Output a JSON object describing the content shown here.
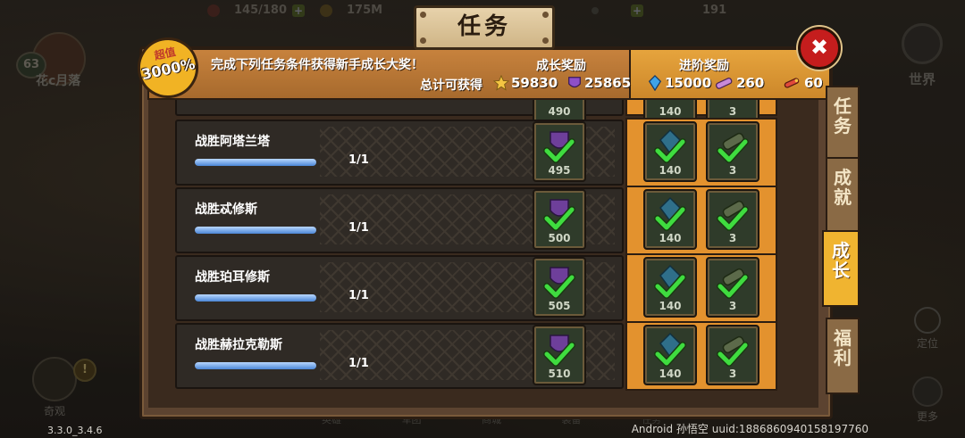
{
  "hud": {
    "energy": "145/180",
    "gold": "175M",
    "gems": "191"
  },
  "profile": {
    "level": "63",
    "name": "花c月落"
  },
  "world_label": "世界",
  "locate_label": "定位",
  "more_label": "更多",
  "wonder_label": "奇观",
  "bottom_nav": [
    "英雄",
    "军团",
    "商城",
    "装备",
    "任务"
  ],
  "window": {
    "title": "任务",
    "badge_top": "超值",
    "badge_value": "3000%",
    "header_text": "完成下列任务条件获得新手成长大奖！",
    "grow_reward_label": "成长奖励",
    "advanced_reward_label": "进阶奖励",
    "total_label": "总计可获得",
    "totals": {
      "stars": "59830",
      "purple_gems": "25865",
      "blue_crystals": "15000",
      "scrolls": "260",
      "rockets": "60"
    },
    "close_icon": "close-x"
  },
  "tasks": [
    {
      "name": "战胜阿塔兰塔",
      "progress": "1/1",
      "progress_fraction": 1.0,
      "reward": "495",
      "adv_crystal": "140",
      "adv_item": "3"
    },
    {
      "name": "战胜忒修斯",
      "progress": "1/1",
      "progress_fraction": 1.0,
      "reward": "500",
      "adv_crystal": "140",
      "adv_item": "3"
    },
    {
      "name": "战胜珀耳修斯",
      "progress": "1/1",
      "progress_fraction": 1.0,
      "reward": "505",
      "adv_crystal": "140",
      "adv_item": "3"
    },
    {
      "name": "战胜赫拉克勒斯",
      "progress": "1/1",
      "progress_fraction": 1.0,
      "reward": "510",
      "adv_crystal": "140",
      "adv_item": "3"
    }
  ],
  "partial_row": {
    "reward": "490",
    "adv_crystal": "140",
    "adv_item": "3"
  },
  "tabs": [
    {
      "label": "任务",
      "active": false
    },
    {
      "label": "成就",
      "active": false
    },
    {
      "label": "成长",
      "active": true
    },
    {
      "label": "福利",
      "active": false
    }
  ],
  "footer": {
    "version": "3.3.0_3.4.6",
    "device": "Android 孙悟空 uuid:1886860940158197760"
  },
  "colors": {
    "accent": "#f0b430",
    "close": "#c51d1d",
    "check": "#3fdc3f",
    "bar": "#4b86d6"
  }
}
